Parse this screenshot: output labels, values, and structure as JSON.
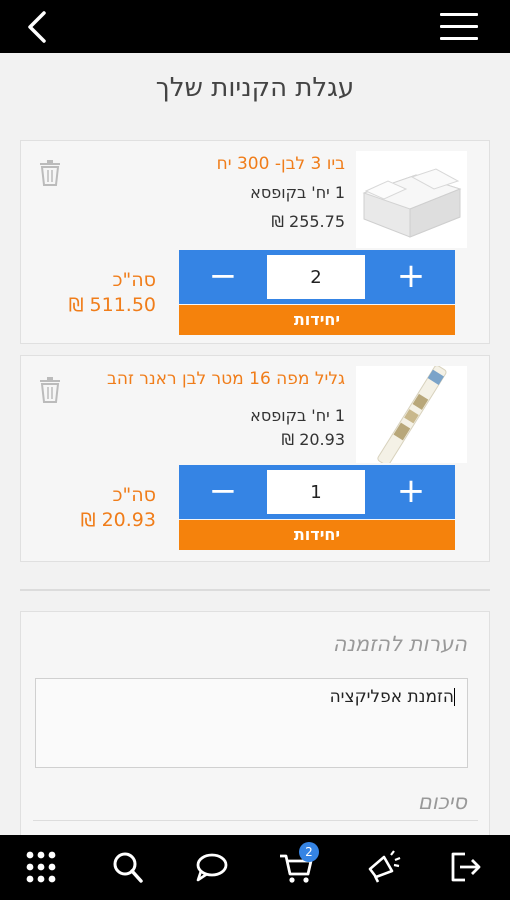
{
  "header": {
    "back_icon": "chevron-left-icon",
    "menu_icon": "hamburger-menu-icon"
  },
  "page": {
    "title": "עגלת הקניות שלך"
  },
  "cart": {
    "items": [
      {
        "name": "ביו 3 לבן- 300 יח",
        "pack": "1 יח' בקופסא",
        "price": "255.75 ₪",
        "quantity": "2",
        "unit_label": "יחידות",
        "total_label": "סה\"כ",
        "total": "511.50 ₪",
        "thumbnail": "white-food-box-image"
      },
      {
        "name": "גליל מפה 16 מטר לבן ראנר זהב",
        "pack": "1 יח' בקופסא",
        "price": "20.93 ₪",
        "quantity": "1",
        "unit_label": "יחידות",
        "total_label": "סה\"כ",
        "total": "20.93 ₪",
        "thumbnail": "table-roll-image"
      }
    ],
    "minus_label": "−",
    "plus_label": "+"
  },
  "notes": {
    "title": "הערות להזמנה",
    "value": "הזמנת אפליקציה"
  },
  "summary": {
    "title": "סיכום"
  },
  "bottom_nav": {
    "items": [
      "grid-menu-icon",
      "search-icon",
      "chat-icon",
      "cart-icon",
      "megaphone-icon",
      "logout-icon"
    ],
    "cart_badge": "2"
  },
  "colors": {
    "accent_orange": "#f07d1a",
    "qty_blue": "#3584e4",
    "unit_orange": "#f5820c",
    "bar_black": "#000000"
  }
}
